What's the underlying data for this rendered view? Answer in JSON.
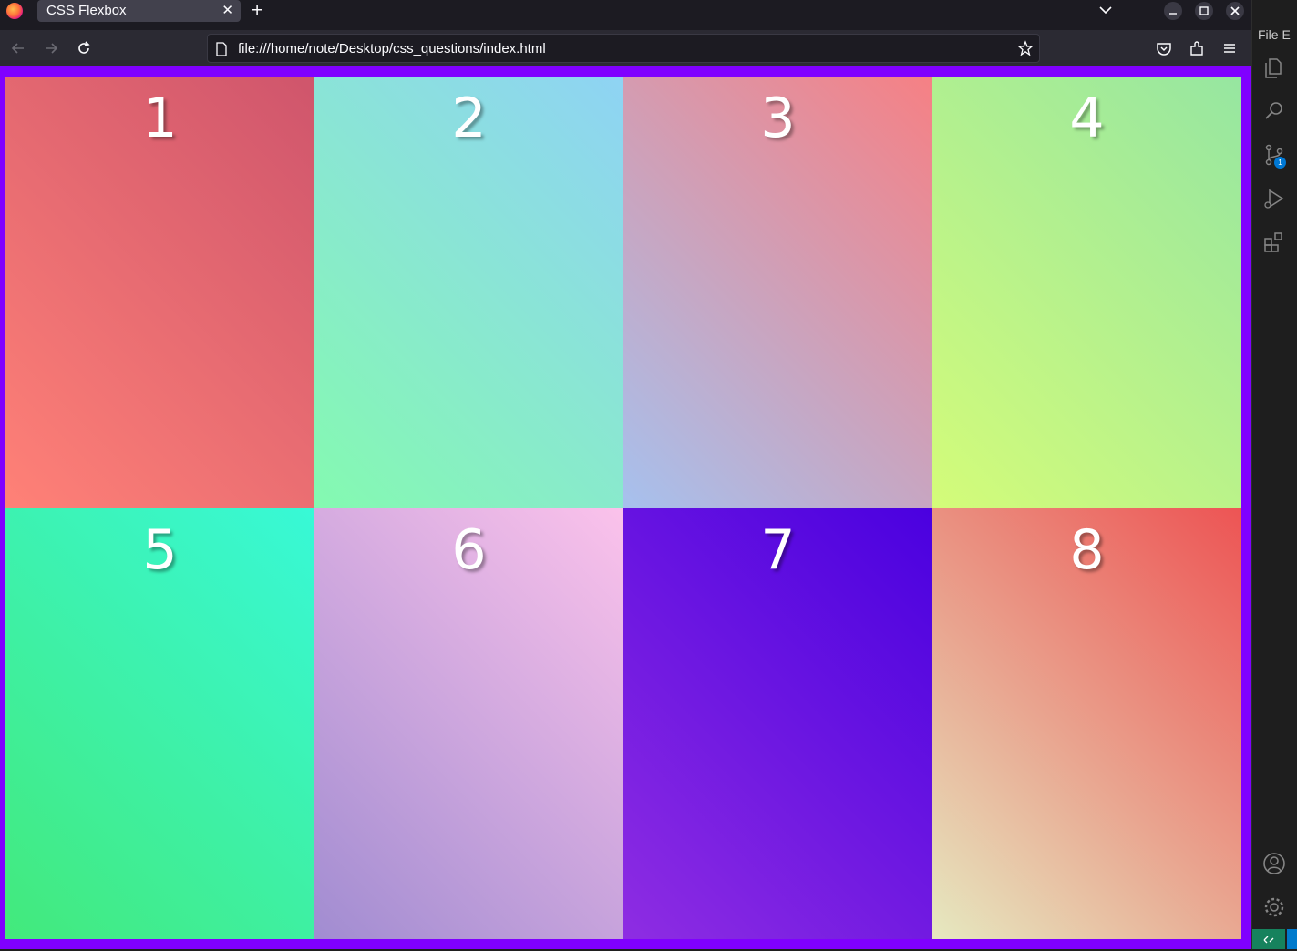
{
  "browser": {
    "tab_title": "CSS Flexbox",
    "tab_close": "✕",
    "new_tab": "+",
    "url": "file:///home/note/Desktop/css_questions/index.html"
  },
  "boxes": [
    {
      "label": "1"
    },
    {
      "label": "2"
    },
    {
      "label": "3"
    },
    {
      "label": "4"
    },
    {
      "label": "5"
    },
    {
      "label": "6"
    },
    {
      "label": "7"
    },
    {
      "label": "8"
    }
  ],
  "vscode": {
    "menu": "File  E",
    "scm_badge": "1"
  },
  "colors": {
    "page_background": "#8000ff"
  }
}
